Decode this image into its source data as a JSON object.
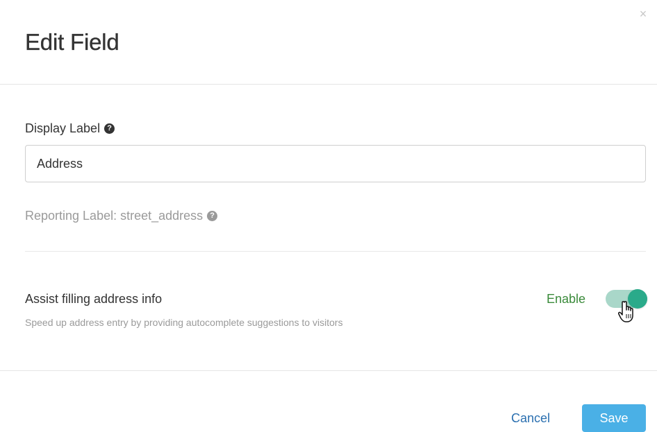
{
  "modal": {
    "title": "Edit Field",
    "close_icon": "close-icon",
    "close_glyph": "×"
  },
  "display_label": {
    "label": "Display Label",
    "help_icon": "question-circle-icon",
    "help_glyph": "?",
    "value": "Address"
  },
  "reporting": {
    "text": "Reporting Label: street_address",
    "help_icon": "question-circle-icon",
    "help_glyph": "?"
  },
  "assist": {
    "title": "Assist filling address info",
    "description": "Speed up address entry by providing autocomplete suggestions to visitors",
    "toggle_label": "Enable",
    "toggle_on": true
  },
  "footer": {
    "cancel_label": "Cancel",
    "save_label": "Save"
  },
  "colors": {
    "primary_button": "#4ab0e6",
    "toggle_on": "#2aaa8a",
    "enable_text": "#3a8a3a",
    "link": "#2a6fb0"
  }
}
